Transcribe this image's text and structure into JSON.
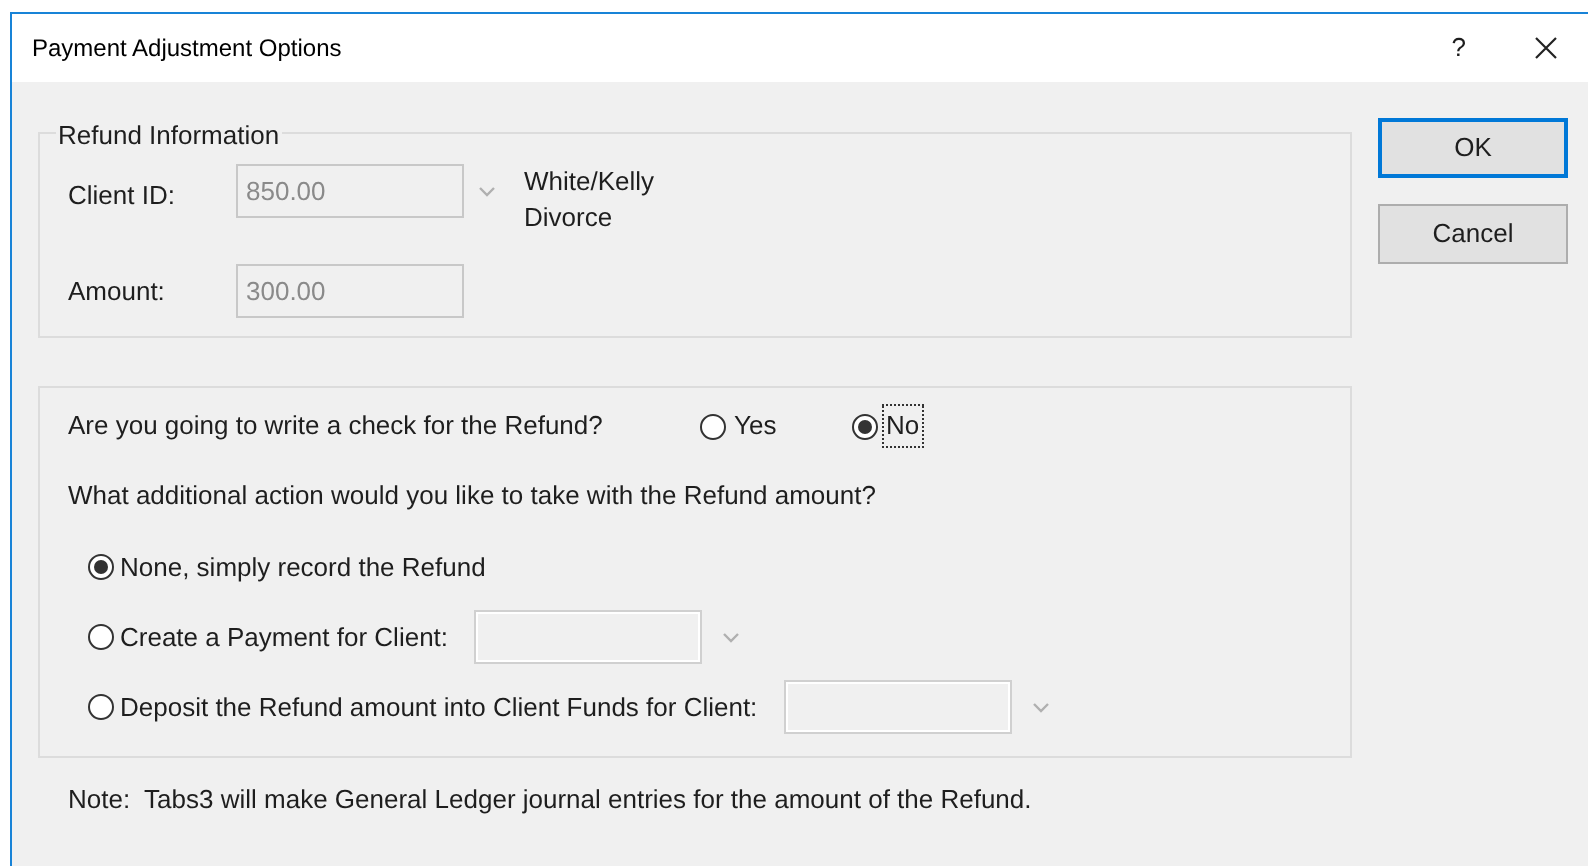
{
  "window": {
    "title": "Payment Adjustment Options",
    "help": "?"
  },
  "refund_information": {
    "legend": "Refund Information",
    "client_id": {
      "label": "Client ID:",
      "value": "850.00"
    },
    "client_name": "White/Kelly Divorce",
    "amount": {
      "label": "Amount:",
      "value": "300.00"
    }
  },
  "check_question": {
    "label": "Are you going to write a check for the Refund?",
    "options": [
      {
        "label": "Yes",
        "selected": false,
        "focused": false
      },
      {
        "label": "No",
        "selected": true,
        "focused": true
      }
    ]
  },
  "action_question": "What additional action would you like to take with the Refund amount?",
  "actions": [
    {
      "label": "None, simply record the Refund",
      "selected": true,
      "kind": "plain"
    },
    {
      "label": "Create a Payment for Client:",
      "selected": false,
      "kind": "dropdown"
    },
    {
      "label": "Deposit the Refund amount into Client Funds for Client:",
      "selected": false,
      "kind": "dropdown"
    }
  ],
  "note": "Note:  Tabs3 will make General Ledger journal entries for the amount of the Refund.",
  "buttons": [
    {
      "label": "OK",
      "default": true
    },
    {
      "label": "Cancel",
      "default": false
    }
  ]
}
